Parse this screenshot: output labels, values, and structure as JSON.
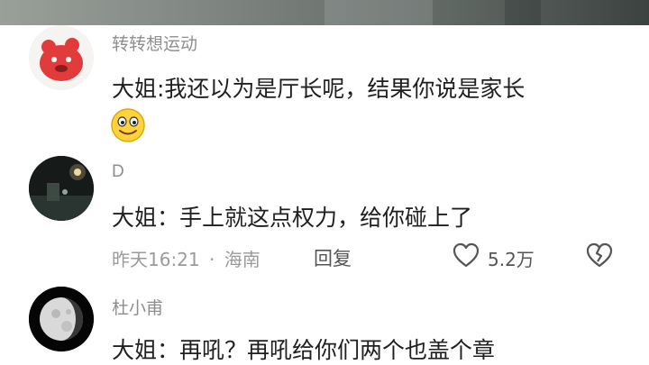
{
  "comments": [
    {
      "username": "转转想运动",
      "text": "大姐:我还以为是厅长呢，结果你说是家长",
      "emoji": "grinning-face-emoji",
      "avatar": "red-bear-cartoon-avatar"
    },
    {
      "username": "D",
      "text": "大姐：手上就这点权力，给你碰上了",
      "time": "昨天16:21",
      "separator": "·",
      "location": "海南",
      "reply_label": "回复",
      "like_count": "5.2万",
      "avatar": "night-street-photo-avatar"
    },
    {
      "username": "杜小甫",
      "text": "大姐：再吼？再吼给你们两个也盖个章",
      "avatar": "moon-photo-avatar"
    }
  ],
  "colors": {
    "username": "#8e8e8e",
    "text": "#1f1f1f",
    "meta": "#9a9a9a",
    "avatar_red": "#e23b3b"
  }
}
